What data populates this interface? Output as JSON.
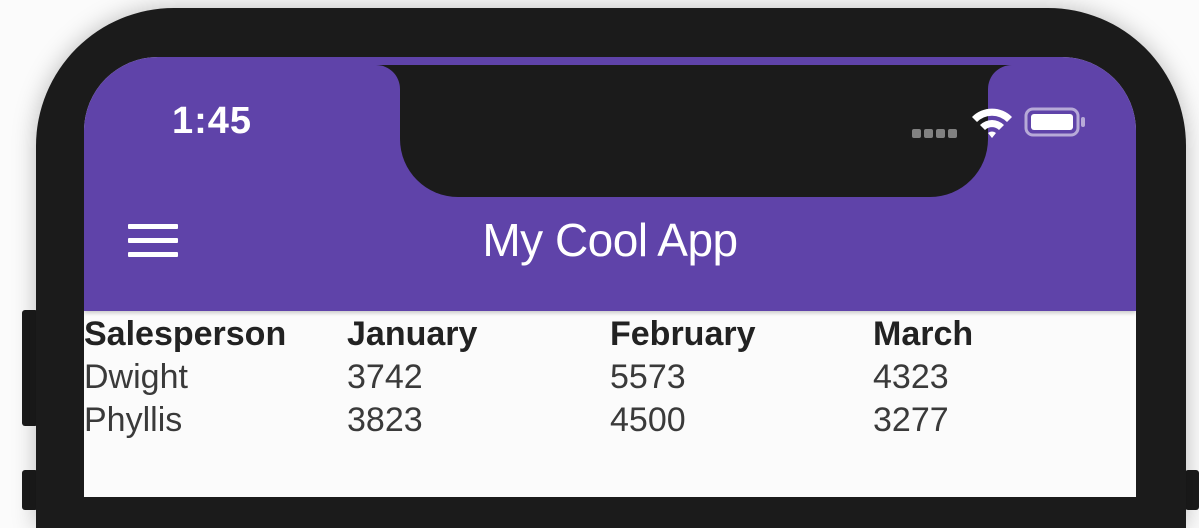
{
  "status_bar": {
    "time": "1:45",
    "wifi_icon": "wifi-icon",
    "battery_icon": "battery-icon",
    "signal_icon": "cellular-signal-icon"
  },
  "app_bar": {
    "title": "My Cool App",
    "menu_icon": "hamburger-menu-icon",
    "background_color": "#5f43a9"
  },
  "table": {
    "columns": [
      "Salesperson",
      "January",
      "February",
      "March"
    ],
    "rows": [
      [
        "Dwight",
        "3742",
        "5573",
        "4323"
      ],
      [
        "Phyllis",
        "3823",
        "4500",
        "3277"
      ]
    ]
  }
}
